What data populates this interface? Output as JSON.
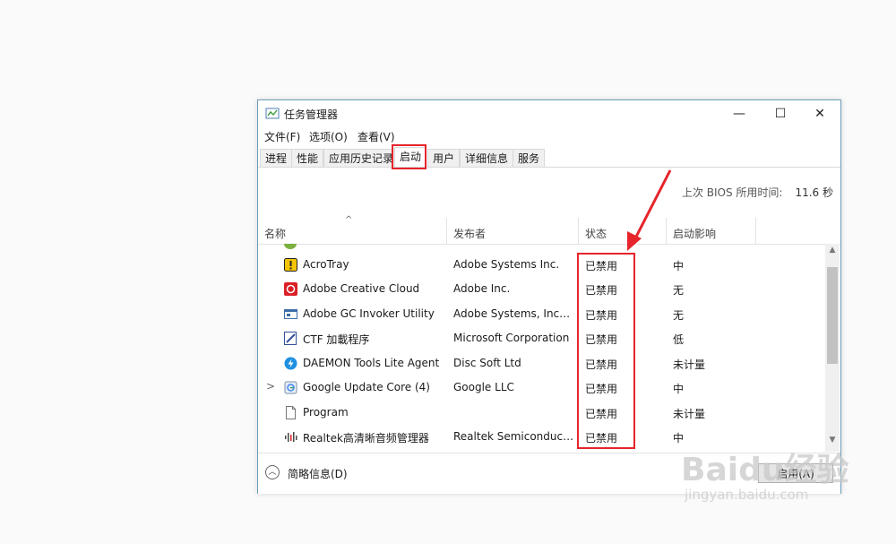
{
  "window": {
    "title": "任务管理器"
  },
  "window_buttons": {
    "minimize": "—",
    "maximize": "☐",
    "close": "✕"
  },
  "menu": [
    "文件(F)",
    "选项(O)",
    "查看(V)"
  ],
  "tabs": [
    "进程",
    "性能",
    "应用历史记录",
    "启动",
    "用户",
    "详细信息",
    "服务"
  ],
  "active_tab": "启动",
  "bios": {
    "label": "上次 BIOS 所用时间:",
    "value": "11.6 秒"
  },
  "columns": {
    "name": "名称",
    "publisher": "发布者",
    "status": "状态",
    "impact": "启动影响"
  },
  "rows": [
    {
      "name": "AcroTray",
      "publisher": "Adobe Systems Inc.",
      "status": "已禁用",
      "impact": "中",
      "icon": "acrotray-icon",
      "chevron": ""
    },
    {
      "name": "Adobe Creative Cloud",
      "publisher": "Adobe Inc.",
      "status": "已禁用",
      "impact": "无",
      "icon": "creative-cloud-icon",
      "chevron": ""
    },
    {
      "name": "Adobe GC Invoker Utility",
      "publisher": "Adobe Systems, Incorpo...",
      "status": "已禁用",
      "impact": "无",
      "icon": "gc-invoker-icon",
      "chevron": ""
    },
    {
      "name": "CTF 加載程序",
      "publisher": "Microsoft Corporation",
      "status": "已禁用",
      "impact": "低",
      "icon": "ctf-loader-icon",
      "chevron": ""
    },
    {
      "name": "DAEMON Tools Lite Agent",
      "publisher": "Disc Soft Ltd",
      "status": "已禁用",
      "impact": "未计量",
      "icon": "daemon-tools-icon",
      "chevron": ""
    },
    {
      "name": "Google Update Core (4)",
      "publisher": "Google LLC",
      "status": "已禁用",
      "impact": "中",
      "icon": "google-update-icon",
      "chevron": ">"
    },
    {
      "name": "Program",
      "publisher": "",
      "status": "已禁用",
      "impact": "未计量",
      "icon": "program-file-icon",
      "chevron": ""
    },
    {
      "name": "Realtek高清晰音频管理器",
      "publisher": "Realtek Semiconductor",
      "status": "已禁用",
      "impact": "中",
      "icon": "realtek-audio-icon",
      "chevron": ""
    }
  ],
  "footer": {
    "fewer_details": "简略信息(D)",
    "disable_button": "启用(A)"
  },
  "watermark": {
    "logo": "Baidu经验",
    "url": "jingyan.baidu.com"
  },
  "colors": {
    "highlight": "#e6242b",
    "window_border": "#6b9bb8"
  }
}
